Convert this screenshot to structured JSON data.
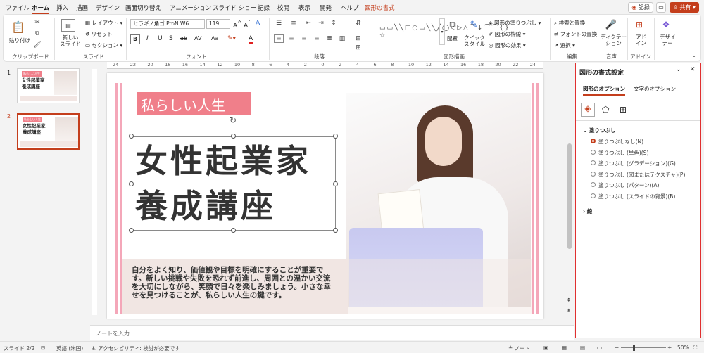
{
  "tabs": [
    "ファイル",
    "ホーム",
    "挿入",
    "描画",
    "デザイン",
    "画面切り替え",
    "アニメーション",
    "スライド ショー",
    "記録",
    "校閲",
    "表示",
    "開発",
    "ヘルプ",
    "図形の書式"
  ],
  "top_buttons": {
    "record": "記録",
    "share": "共有"
  },
  "ribbon": {
    "clipboard": {
      "paste": "貼り付け",
      "label": "クリップボード"
    },
    "slides": {
      "new_slide": "新しい\nスライド",
      "layout": "レイアウト",
      "reset": "リセット",
      "section": "セクション",
      "label": "スライド"
    },
    "font": {
      "font_name": "ヒラギノ角ゴ ProN W6",
      "font_size": "119",
      "label": "フォント",
      "bold": "B",
      "italic": "I",
      "underline": "U",
      "strike": "S",
      "shadow": "ab",
      "spacing": "AV",
      "case": "Aa",
      "clear": "A",
      "highlight": "A",
      "color": "A",
      "grow": "A",
      "shrink": "A"
    },
    "paragraph": {
      "label": "段落"
    },
    "drawing": {
      "arrange": "配置",
      "quick_style": "クイック\nスタイル",
      "fill": "図形の塗りつぶし",
      "outline": "図形の枠線",
      "effects": "図形の効果",
      "label": "図形描画"
    },
    "editing": {
      "find": "検索と置換",
      "replace": "フォントの置換",
      "select": "選択",
      "label": "編集"
    },
    "voice": {
      "dictate": "ディクテー\nション",
      "label": "音声"
    },
    "addins": {
      "addins": "アド\nイン",
      "label": "アドイン"
    },
    "designer": {
      "designer": "デザイ\nナー"
    }
  },
  "ruler_ticks": [
    "24",
    "22",
    "20",
    "18",
    "16",
    "14",
    "12",
    "10",
    "8",
    "6",
    "4",
    "2",
    "0",
    "2",
    "4",
    "6",
    "8",
    "10",
    "12",
    "14",
    "16",
    "18",
    "20",
    "22",
    "24"
  ],
  "thumbnails": [
    {
      "num": "1",
      "badge": "私らしい人生",
      "title": "女性起業家\n養成講座"
    },
    {
      "num": "2",
      "badge": "私らしい人生",
      "title": "女性起業家\n養成講座"
    }
  ],
  "slide": {
    "badge": "私らしい人生",
    "title_line1": "女性起業家",
    "title_line2": "養成講座",
    "body": "自分をよく知り、価値観や目標を明確にすることが重要です。新しい挑戦や失敗を恐れず前進し、周囲との温かい交流を大切にしながら、笑顔で日々を楽しみましょう。小さな幸せを見つけることが、私らしい人生の鍵です。"
  },
  "notes_placeholder": "ノートを入力",
  "pane": {
    "title": "図形の書式設定",
    "tab_shape": "図形のオプション",
    "tab_text": "文字のオプション",
    "section_fill": "塗りつぶし",
    "section_line": "線",
    "fill_options": [
      {
        "label": "塗りつぶしなし(N)",
        "selected": true
      },
      {
        "label": "塗りつぶし (単色)(S)",
        "selected": false
      },
      {
        "label": "塗りつぶし (グラデーション)(G)",
        "selected": false
      },
      {
        "label": "塗りつぶし (図またはテクスチャ)(P)",
        "selected": false
      },
      {
        "label": "塗りつぶし (パターン)(A)",
        "selected": false
      },
      {
        "label": "塗りつぶし (スライドの背景)(B)",
        "selected": false
      }
    ]
  },
  "status": {
    "slide": "スライド 2/2",
    "lang": "英語 (米国)",
    "accessibility": "アクセシビリティ: 検討が必要です",
    "notes": "ノート",
    "zoom": "50%"
  },
  "colors": {
    "accent": "#c43e1c",
    "pink": "#f07f8a",
    "pink_stripe": "#f4a7b9"
  }
}
